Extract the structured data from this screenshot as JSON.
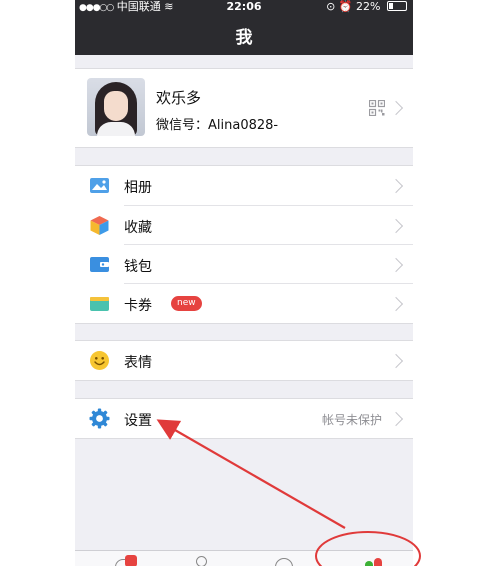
{
  "status_bar": {
    "carrier": "中国联通",
    "time": "22:06",
    "battery": "22%",
    "battery_level": 0.22
  },
  "nav": {
    "title": "我"
  },
  "profile": {
    "name": "欢乐多",
    "wechat_id": "微信号：Alina0828-",
    "qr_icon": "qr-code-icon"
  },
  "menu_group_1": [
    {
      "label": "相册",
      "icon": "photo-album-icon",
      "color": "#4fa0e8"
    },
    {
      "label": "收藏",
      "icon": "favorites-cube-icon",
      "color": "#f5a623"
    },
    {
      "label": "钱包",
      "icon": "wallet-icon",
      "color": "#3a8fe0"
    },
    {
      "label": "卡券",
      "icon": "card-ticket-icon",
      "color": "#49c2ae",
      "badge": "new"
    }
  ],
  "menu_group_2": [
    {
      "label": "表情",
      "icon": "emoji-icon",
      "color": "#f7c631"
    }
  ],
  "menu_group_3": [
    {
      "label": "设置",
      "icon": "settings-gear-icon",
      "color": "#2f88d6",
      "right_text": "帐号未保护"
    }
  ],
  "tab_bar": {
    "icons": [
      "chats-tab-icon",
      "contacts-tab-icon",
      "discover-tab-icon",
      "me-tab-icon"
    ]
  },
  "colors": {
    "nav_bg": "#2b2b2f",
    "page_bg": "#efeff4",
    "badge_red": "#e64340",
    "annotation_red": "#e03a3a"
  }
}
